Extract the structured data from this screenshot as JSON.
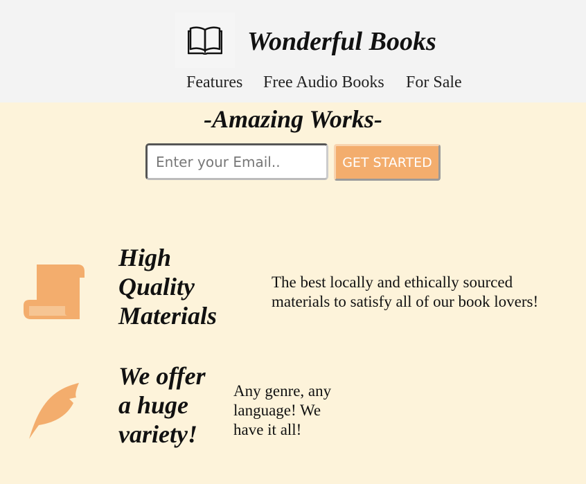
{
  "header": {
    "logo_icon": "open-book-icon",
    "title": "Wonderful Books",
    "nav": [
      {
        "label": "Features"
      },
      {
        "label": "Free Audio Books"
      },
      {
        "label": "For Sale"
      }
    ]
  },
  "hero": {
    "title": "-Amazing Works-",
    "email_placeholder": "Enter your Email..",
    "cta_label": "GET STARTED"
  },
  "features": [
    {
      "icon": "scroll-icon",
      "title_lines": [
        "High",
        "Quality",
        "Materials"
      ],
      "text_lines": [
        "The best locally and ethically sourced",
        "materials to satisfy all of our book lovers!"
      ]
    },
    {
      "icon": "feather-icon",
      "title_lines": [
        "We offer",
        "a huge",
        "variety!"
      ],
      "text_lines": [
        "Any genre, any",
        "language! We",
        "have it all!"
      ]
    }
  ],
  "colors": {
    "accent": "#f3ad6d",
    "background": "#fdf3da",
    "header_bg": "#f3f3f3"
  }
}
